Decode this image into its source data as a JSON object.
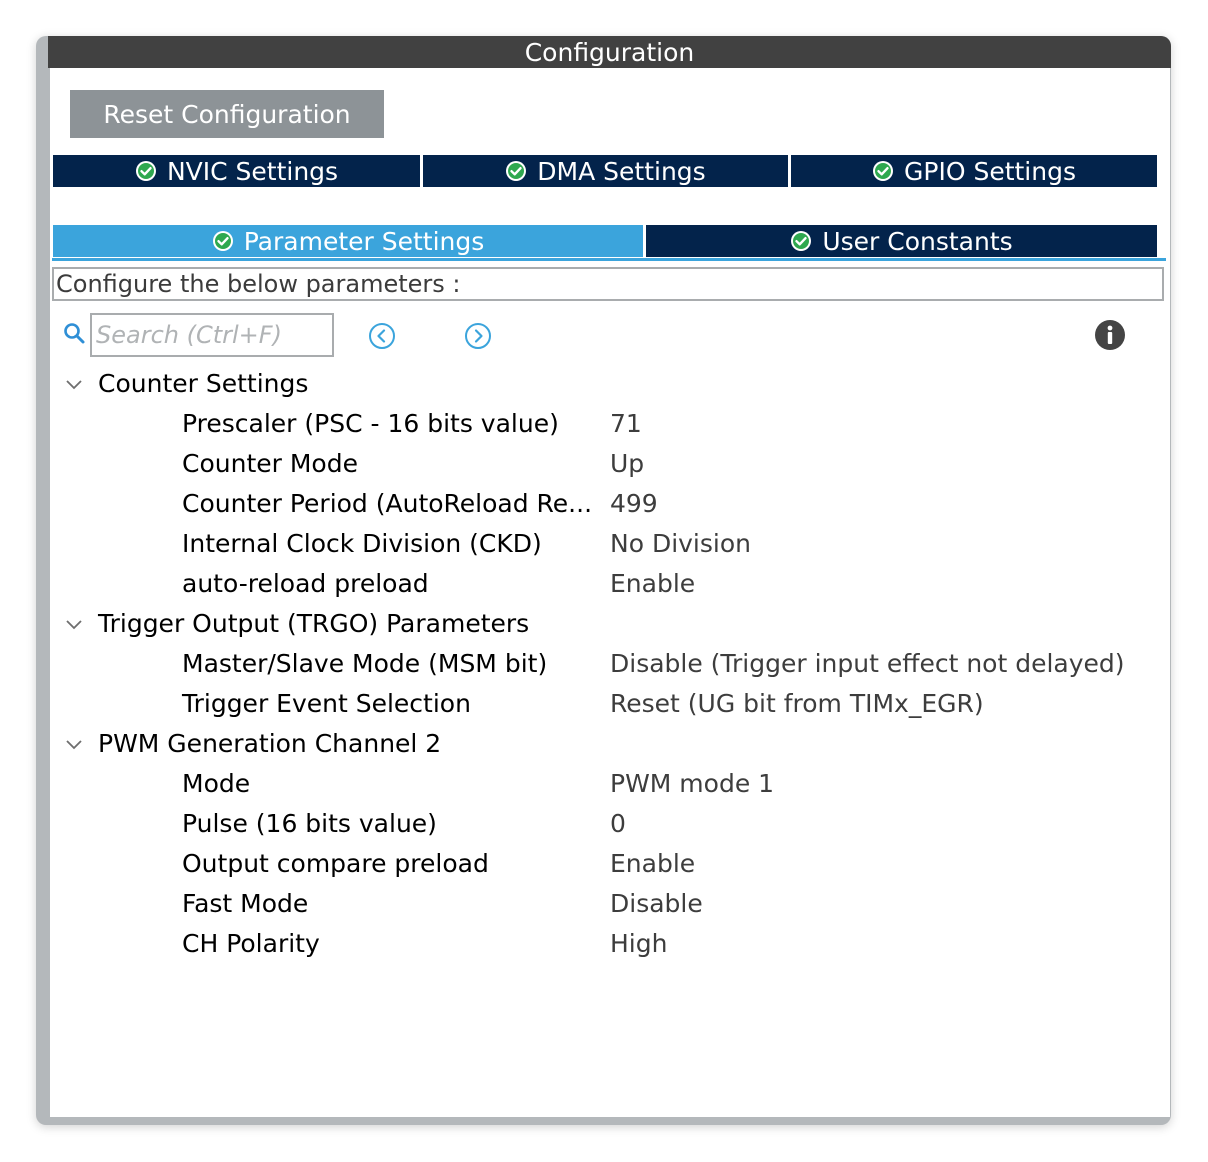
{
  "window": {
    "title": "Configuration"
  },
  "reset_button": {
    "label": "Reset Configuration"
  },
  "tabs": [
    {
      "label": "NVIC Settings",
      "active": false
    },
    {
      "label": "DMA Settings",
      "active": false
    },
    {
      "label": "GPIO Settings",
      "active": false
    },
    {
      "label": "Parameter Settings",
      "active": true
    },
    {
      "label": "User Constants",
      "active": false
    }
  ],
  "description": "Configure the below parameters :",
  "search": {
    "placeholder": "Search (Ctrl+F)",
    "value": ""
  },
  "icons": {
    "search": "search-icon",
    "previous": "arrow-left-circle-icon",
    "next": "arrow-right-circle-icon",
    "info": "info-icon",
    "tab_status": "check-circle-icon",
    "group_toggle": "chevron-down-icon"
  },
  "colors": {
    "tab_background": "#03234b",
    "tab_active": "#3ba4dc",
    "check": "#2fa84f",
    "titlebar": "#414141",
    "button": "#8d9397"
  },
  "groups": [
    {
      "label": "Counter Settings",
      "params": [
        {
          "label": "Prescaler (PSC - 16 bits value)",
          "value": "71"
        },
        {
          "label": "Counter Mode",
          "value": "Up"
        },
        {
          "label": "Counter Period (AutoReload Re...",
          "value": "499"
        },
        {
          "label": "Internal Clock Division (CKD)",
          "value": "No Division"
        },
        {
          "label": "auto-reload preload",
          "value": "Enable"
        }
      ]
    },
    {
      "label": "Trigger Output (TRGO) Parameters",
      "params": [
        {
          "label": "Master/Slave Mode (MSM bit)",
          "value": "Disable (Trigger input effect not delayed)"
        },
        {
          "label": "Trigger Event Selection",
          "value": "Reset (UG bit from TIMx_EGR)"
        }
      ]
    },
    {
      "label": "PWM Generation Channel 2",
      "params": [
        {
          "label": "Mode",
          "value": "PWM mode 1"
        },
        {
          "label": "Pulse (16 bits value)",
          "value": "0"
        },
        {
          "label": "Output compare preload",
          "value": "Enable"
        },
        {
          "label": "Fast Mode",
          "value": "Disable"
        },
        {
          "label": "CH Polarity",
          "value": "High"
        }
      ]
    }
  ]
}
